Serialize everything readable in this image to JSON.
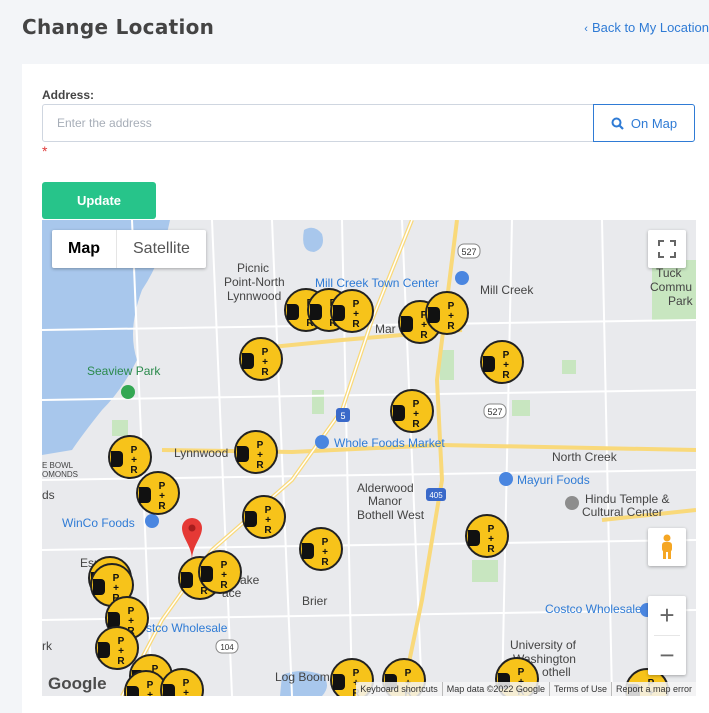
{
  "header": {
    "title": "Change Location",
    "back_label": "Back to My Location"
  },
  "form": {
    "address_label": "Address:",
    "address_placeholder": "Enter the address",
    "address_value": "",
    "on_map_label": "On Map",
    "required_marker": "*",
    "update_label": "Update"
  },
  "map": {
    "type_map": "Map",
    "type_satellite": "Satellite",
    "google_logo": "Google",
    "attribution": [
      "Keyboard shortcuts",
      "Map data ©2022 Google",
      "Terms of Use",
      "Report a map error"
    ],
    "place_labels": [
      "Picnic",
      "Point-North",
      "Lynnwood",
      "Mill Creek Town Center",
      "Mill Creek",
      "Mar",
      "Seaview Park",
      "Whole Foods Market",
      "North Creek",
      "Mayuri Foods",
      "Hindu Temple &",
      "Cultural Center",
      "Lynnwood",
      "Alderwood",
      "Manor",
      "Bothell West",
      "WinCo Foods",
      "Brier",
      "Costco Wholesale",
      "stco Wholesale",
      "University of",
      "Washington",
      "othell",
      "Log Boom",
      "ake",
      "ace",
      "Esp",
      "ds",
      "rk",
      "Tuck",
      "Commu",
      "Park",
      "E BOWL",
      "OMONDS"
    ],
    "route_shields": [
      "527",
      "527",
      "5",
      "405",
      "104"
    ],
    "marker_text": "P+R",
    "accent": "#2f7bd5",
    "update_color": "#27c48a",
    "marker_color": "#f7c31a"
  }
}
